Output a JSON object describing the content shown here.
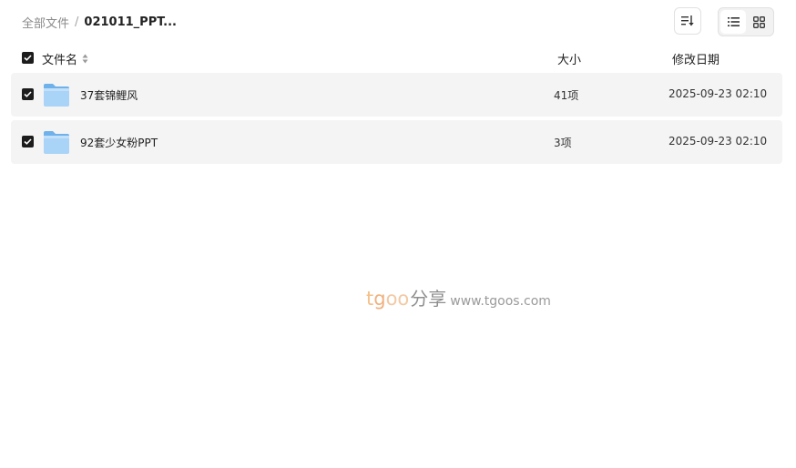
{
  "breadcrumb": {
    "root": "全部文件",
    "separator": "/",
    "current": "021011_PPT..."
  },
  "toolbar": {
    "sort_icon": "sort-icon",
    "view_list_icon": "list-view-icon",
    "view_grid_icon": "grid-view-icon",
    "active_view": "list"
  },
  "table": {
    "headers": {
      "name": "文件名",
      "size": "大小",
      "date": "修改日期"
    },
    "rows": [
      {
        "name": "37套锦鲤风",
        "size": "41项",
        "date": "2025-09-23 02:10",
        "checked": true
      },
      {
        "name": "92套少女粉PPT",
        "size": "3项",
        "date": "2025-09-23 02:10",
        "checked": true
      }
    ]
  },
  "watermark": {
    "brand_t": "t",
    "brand_g": "g",
    "brand_oo": "oo",
    "brand_cn": "分享",
    "url": "www.tgoos.com"
  },
  "colors": {
    "checkbox": "#1c1c1c",
    "row_bg": "#f4f4f4",
    "folder_light": "#a9d3f7",
    "folder_dark": "#6fb1ea"
  }
}
